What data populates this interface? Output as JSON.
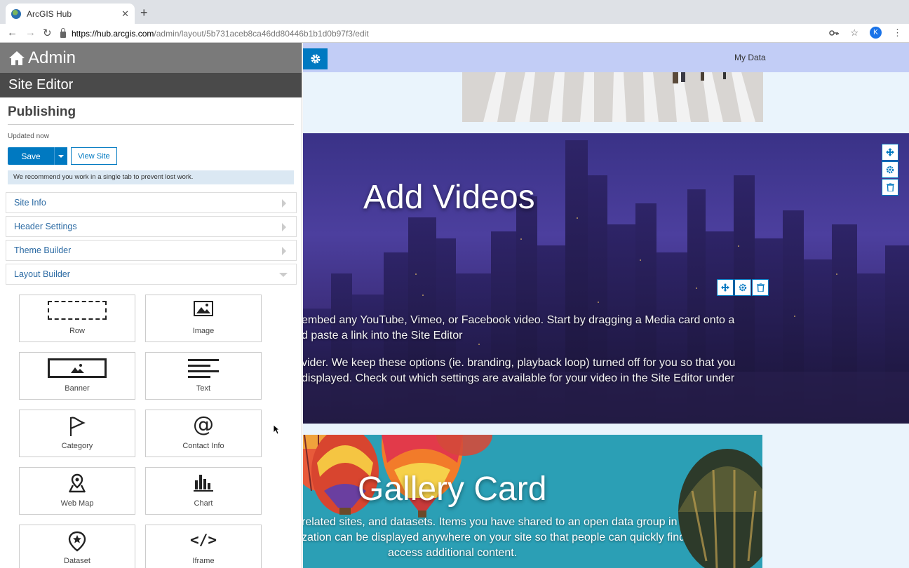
{
  "browser": {
    "tab_title": "ArcGIS Hub",
    "url_host": "https://hub.arcgis.com",
    "url_path": "/admin/layout/5b731aceb8ca46dd80446b1b1d0b97f3/edit",
    "profile_initial": "K"
  },
  "panel": {
    "admin_title": "Admin",
    "editor_title": "Site Editor",
    "publishing_heading": "Publishing",
    "updated_text": "Updated now",
    "save_label": "Save",
    "view_site_label": "View Site",
    "notice": "We recommend you work in a single tab to prevent lost work.",
    "accordion": [
      {
        "label": "Site Info"
      },
      {
        "label": "Header Settings"
      },
      {
        "label": "Theme Builder"
      },
      {
        "label": "Layout Builder"
      }
    ],
    "cards": [
      {
        "label": "Row",
        "icon": "row-icon"
      },
      {
        "label": "Image",
        "icon": "image-icon"
      },
      {
        "label": "Banner",
        "icon": "banner-icon"
      },
      {
        "label": "Text",
        "icon": "text-icon"
      },
      {
        "label": "Category",
        "icon": "flag-icon"
      },
      {
        "label": "Contact Info",
        "icon": "at-icon"
      },
      {
        "label": "Web Map",
        "icon": "map-pin-icon"
      },
      {
        "label": "Chart",
        "icon": "chart-icon"
      },
      {
        "label": "Dataset",
        "icon": "dataset-pin-icon"
      },
      {
        "label": "Iframe",
        "icon": "code-icon"
      }
    ]
  },
  "preview": {
    "nav_link": "My Data",
    "videos_title": "Add Videos",
    "videos_lines": [
      "embed any YouTube, Vimeo, or Facebook video. Start by dragging a Media card onto a",
      "d paste a link into the Site Editor",
      "vider. We keep these options (ie. branding, playback loop) turned off for you so that you",
      "displayed. Check out which settings are available for your video in the Site Editor under"
    ],
    "gallery_title": "Gallery Card",
    "gallery_lines": [
      "related sites, and datasets. Items you have shared to an open data group in your",
      "zation can be displayed anywhere on your site so that people can quickly find and",
      "access additional content."
    ]
  },
  "colors": {
    "accent": "#0079c1",
    "nav_bg": "#c2cdf6",
    "admin_bar": "#7a7a7a",
    "editor_bar": "#4a4a4a"
  }
}
